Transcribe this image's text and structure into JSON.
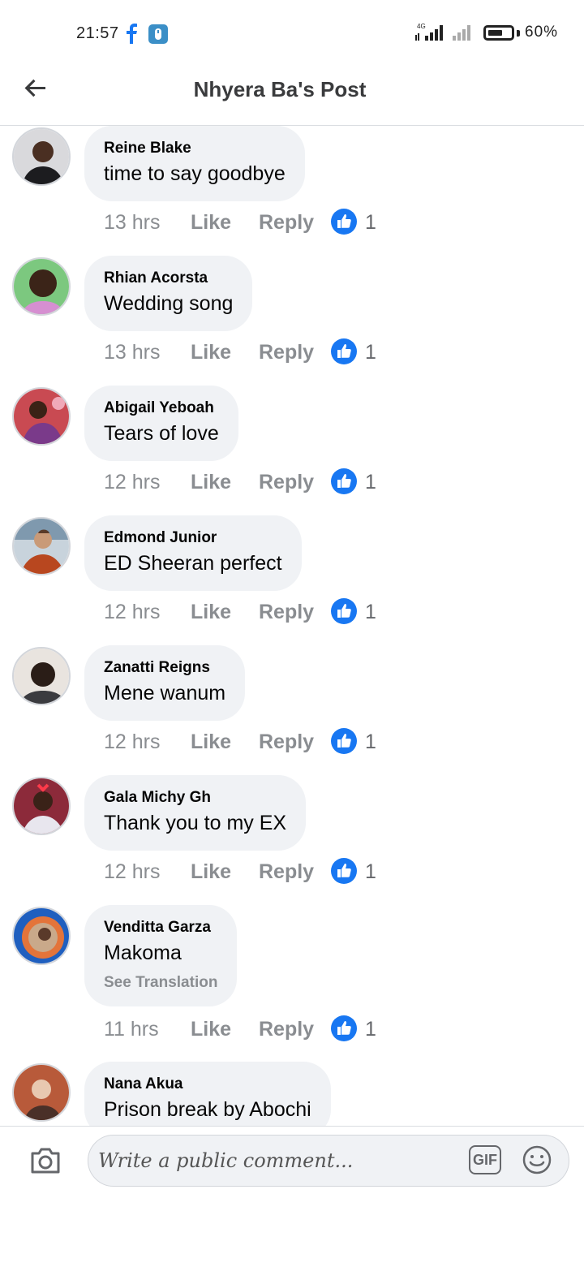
{
  "status_bar": {
    "time": "21:57",
    "network": "4G",
    "battery": "60%",
    "notification_icons": [
      "facebook-icon",
      "app-icon"
    ]
  },
  "header": {
    "title": "Nhyera Ba's Post",
    "back_icon": "back-arrow-icon"
  },
  "comments": [
    {
      "author": "Reine Blake",
      "text": "time to say goodbye",
      "time": "13 hrs",
      "like": "Like",
      "reply": "Reply",
      "reactions": "1"
    },
    {
      "author": "Rhian Acorsta",
      "text": "Wedding song",
      "time": "13 hrs",
      "like": "Like",
      "reply": "Reply",
      "reactions": "1"
    },
    {
      "author": "Abigail Yeboah",
      "text": "Tears of love",
      "time": "12 hrs",
      "like": "Like",
      "reply": "Reply",
      "reactions": "1"
    },
    {
      "author": "Edmond Junior",
      "text": "ED Sheeran perfect",
      "time": "12 hrs",
      "like": "Like",
      "reply": "Reply",
      "reactions": "1"
    },
    {
      "author": "Zanatti Reigns",
      "text": "Mene wanum",
      "time": "12 hrs",
      "like": "Like",
      "reply": "Reply",
      "reactions": "1"
    },
    {
      "author": "Gala Michy Gh",
      "text": "Thank you to my EX",
      "time": "12 hrs",
      "like": "Like",
      "reply": "Reply",
      "reactions": "1"
    },
    {
      "author": "Venditta Garza",
      "text": "Makoma",
      "translate": "See Translation",
      "time": "11 hrs",
      "like": "Like",
      "reply": "Reply",
      "reactions": "1"
    },
    {
      "author": "Nana Akua",
      "text": "Prison break by Abochi"
    }
  ],
  "composer": {
    "placeholder": "Write a public comment...",
    "gif_label": "GIF",
    "camera_icon": "camera-icon",
    "emoji_icon": "emoji-icon"
  },
  "colors": {
    "bubble": "#f0f2f5",
    "like_blue": "#1877f2",
    "meta_gray": "#8a8d91"
  }
}
